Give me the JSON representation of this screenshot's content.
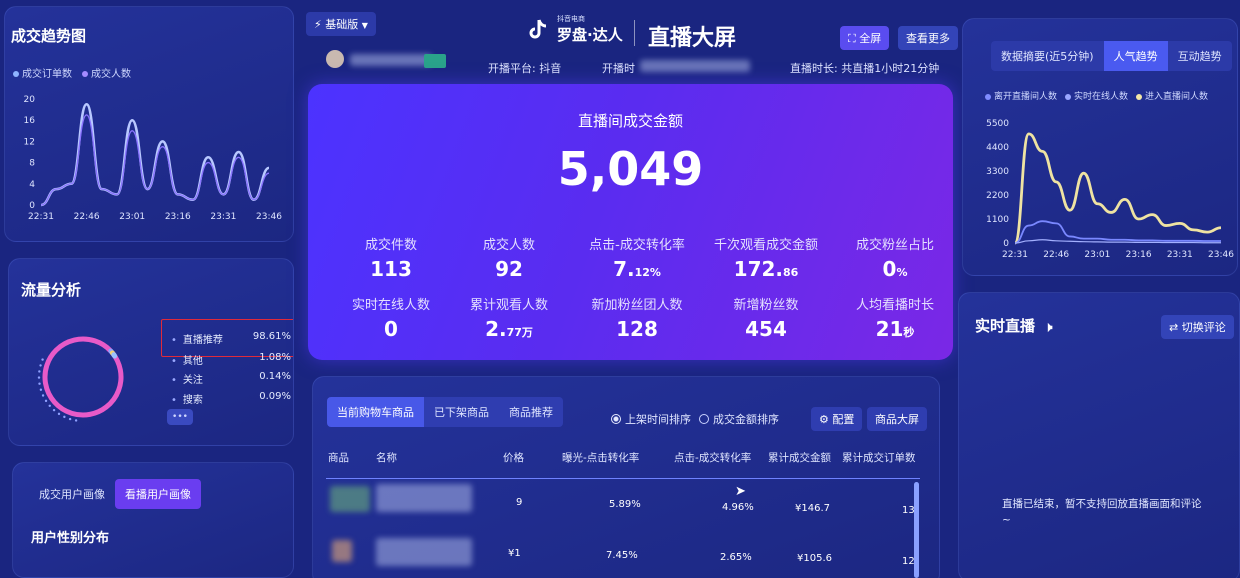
{
  "header": {
    "edition_badge": "基础版",
    "logo_sub": "抖音电商",
    "logo_main": "罗盘·达人",
    "screen_title": "直播大屏",
    "fullscreen_btn": "全屏",
    "more_btn": "查看更多",
    "platform": "开播平台: 抖音",
    "start_time_label": "开播时",
    "duration": "直播时长: 共直播1小时21分钟"
  },
  "trend": {
    "title": "成交趋势图",
    "legend": [
      {
        "name": "成交订单数",
        "color": "#8fb4ff"
      },
      {
        "name": "成交人数",
        "color": "#a58bff"
      }
    ]
  },
  "hero": {
    "label": "直播间成交金额",
    "value": "5,049",
    "metrics": [
      {
        "label": "成交件数",
        "value": "113",
        "unit": ""
      },
      {
        "label": "成交人数",
        "value": "92",
        "unit": ""
      },
      {
        "label": "点击-成交转化率",
        "value": "7.",
        "unit": "12%"
      },
      {
        "label": "千次观看成交金额",
        "value": "172.",
        "unit": "86"
      },
      {
        "label": "成交粉丝占比",
        "value": "0",
        "unit": "%"
      },
      {
        "label": "实时在线人数",
        "value": "0",
        "unit": ""
      },
      {
        "label": "累计观看人数",
        "value": "2.",
        "unit": "77万"
      },
      {
        "label": "新加粉丝团人数",
        "value": "128",
        "unit": ""
      },
      {
        "label": "新增粉丝数",
        "value": "454",
        "unit": ""
      },
      {
        "label": "人均看播时长",
        "value": "21",
        "unit": "秒"
      }
    ]
  },
  "popularity": {
    "tabs": [
      "数据摘要(近5分钟)",
      "人气趋势",
      "互动趋势"
    ],
    "active_tab": 1,
    "legend": [
      {
        "name": "离开直播间人数",
        "color": "#7f8cff"
      },
      {
        "name": "实时在线人数",
        "color": "#9aa6ff"
      },
      {
        "name": "进入直播间人数",
        "color": "#f3e7a6"
      }
    ]
  },
  "traffic": {
    "title": "流量分析",
    "rows": [
      {
        "name": "直播推荐",
        "value": "98.61%"
      },
      {
        "name": "其他",
        "value": "1.08%"
      },
      {
        "name": "关注",
        "value": "0.14%"
      },
      {
        "name": "搜索",
        "value": "0.09%"
      }
    ],
    "more": "•••"
  },
  "user": {
    "tabs": [
      "成交用户画像",
      "看播用户画像"
    ],
    "active_tab": 1,
    "subtitle": "用户性别分布"
  },
  "products": {
    "tabs": [
      "当前购物车商品",
      "已下架商品",
      "商品推荐"
    ],
    "active_tab": 0,
    "sort_options": [
      "上架时间排序",
      "成交金额排序"
    ],
    "config_btn": "配置",
    "screen_btn": "商品大屏",
    "columns": [
      "商品",
      "名称",
      "价格",
      "曝光-点击转化率",
      "点击-成交转化率",
      "累计成交金额",
      "累计成交订单数"
    ],
    "rows": [
      {
        "price": "9",
        "ctr": "5.89%",
        "cvr": "4.96%",
        "gmv": "¥146.7",
        "orders": "13"
      },
      {
        "price": "¥1",
        "ctr": "7.45%",
        "cvr": "2.65%",
        "gmv": "¥105.6",
        "orders": "12"
      }
    ]
  },
  "live": {
    "title": "实时直播",
    "switch_btn": "切换评论",
    "message": "直播已结束，暂不支持回放直播画面和评论~"
  },
  "chart_data": [
    {
      "type": "line",
      "title": "成交趋势图",
      "x": [
        "22:31",
        "22:46",
        "23:01",
        "23:16",
        "23:31",
        "23:46"
      ],
      "ylim": [
        0,
        20
      ],
      "yticks": [
        0,
        4,
        8,
        12,
        16,
        20
      ],
      "series": [
        {
          "name": "成交订单数",
          "values": [
            0,
            3,
            4,
            19,
            3,
            2,
            16,
            3,
            12,
            2,
            1,
            9,
            2,
            10,
            1,
            7
          ]
        },
        {
          "name": "成交人数",
          "values": [
            0,
            3,
            4,
            17,
            3,
            2,
            14,
            3,
            11,
            2,
            1,
            8,
            2,
            9,
            1,
            6
          ]
        }
      ],
      "grid": false
    },
    {
      "type": "line",
      "title": "人气趋势",
      "x": [
        "22:31",
        "22:46",
        "23:01",
        "23:16",
        "23:31",
        "23:46"
      ],
      "ylim": [
        0,
        5500
      ],
      "yticks": [
        0,
        1100,
        2200,
        3300,
        4400,
        5500
      ],
      "series": [
        {
          "name": "进入直播间人数",
          "values": [
            0,
            5000,
            4200,
            2800,
            1500,
            3200,
            1800,
            1400,
            2000,
            1100,
            1300,
            800,
            900,
            600,
            500,
            700
          ]
        },
        {
          "name": "离开直播间人数",
          "values": [
            0,
            800,
            1000,
            900,
            300,
            200,
            200,
            150,
            150,
            120,
            120,
            100,
            100,
            100,
            90,
            90
          ]
        },
        {
          "name": "实时在线人数",
          "values": [
            0,
            100,
            150,
            100,
            80,
            60,
            50,
            40,
            40,
            30,
            30,
            20,
            20,
            20,
            10,
            10
          ]
        }
      ],
      "grid": false
    },
    {
      "type": "pie",
      "title": "流量分析",
      "categories": [
        "直播推荐",
        "其他",
        "关注",
        "搜索"
      ],
      "values": [
        98.61,
        1.08,
        0.14,
        0.09
      ]
    }
  ]
}
